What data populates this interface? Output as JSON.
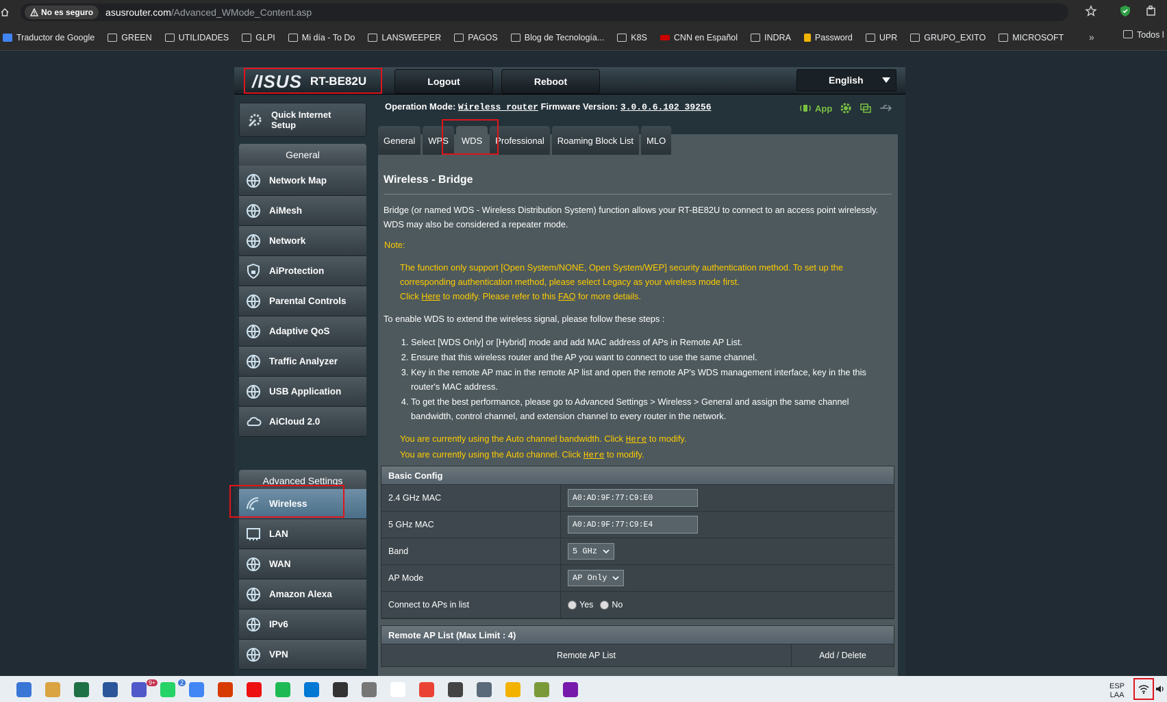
{
  "browser": {
    "security_label": "No es seguro",
    "url_host": "asusrouter.com",
    "url_path": "/Advanced_WMode_Content.asp",
    "bookmarks": [
      {
        "label": "Traductor de Google",
        "icon": "translate-icon"
      },
      {
        "label": "GREEN",
        "icon": "folder-icon"
      },
      {
        "label": "UTILIDADES",
        "icon": "folder-icon"
      },
      {
        "label": "GLPI",
        "icon": "folder-icon"
      },
      {
        "label": "Mi día - To Do",
        "icon": "todo-icon"
      },
      {
        "label": "LANSWEEPER",
        "icon": "folder-icon"
      },
      {
        "label": "PAGOS",
        "icon": "folder-icon"
      },
      {
        "label": "Blog de Tecnología...",
        "icon": "blog-icon"
      },
      {
        "label": "K8S",
        "icon": "folder-icon"
      },
      {
        "label": "CNN en Español",
        "icon": "cnn-icon"
      },
      {
        "label": "INDRA",
        "icon": "folder-icon"
      },
      {
        "label": "Password",
        "icon": "lock-icon"
      },
      {
        "label": "UPR",
        "icon": "folder-icon"
      },
      {
        "label": "GRUPO_EXITO",
        "icon": "folder-icon"
      },
      {
        "label": "MICROSOFT",
        "icon": "folder-icon"
      }
    ],
    "bookmarks_more": "»",
    "bookmarks_all": "Todos l"
  },
  "router": {
    "brand": "/ISUS",
    "model": "RT-BE82U",
    "logout_label": "Logout",
    "reboot_label": "Reboot",
    "language": "English",
    "op_mode_label": "Operation Mode:",
    "op_mode_value": "Wireless router",
    "fw_label": "Firmware Version:",
    "fw_value": "3.0.0.6.102_39256",
    "app_label": "App"
  },
  "sidebar": {
    "qis_label": "Quick Internet Setup",
    "general_header": "General",
    "general_items": [
      {
        "label": "Network Map",
        "icon": "network-map-icon"
      },
      {
        "label": "AiMesh",
        "icon": "aimesh-icon"
      },
      {
        "label": "Network",
        "icon": "globe-icon"
      },
      {
        "label": "AiProtection",
        "icon": "lock-shield-icon"
      },
      {
        "label": "Parental Controls",
        "icon": "family-icon"
      },
      {
        "label": "Adaptive QoS",
        "icon": "gauge-icon"
      },
      {
        "label": "Traffic Analyzer",
        "icon": "analyzer-icon"
      },
      {
        "label": "USB Application",
        "icon": "usb-icon"
      },
      {
        "label": "AiCloud 2.0",
        "icon": "cloud-icon"
      }
    ],
    "advanced_header": "Advanced Settings",
    "advanced_items": [
      {
        "label": "Wireless",
        "icon": "wifi-icon"
      },
      {
        "label": "LAN",
        "icon": "lan-icon"
      },
      {
        "label": "WAN",
        "icon": "globe-icon"
      },
      {
        "label": "Amazon Alexa",
        "icon": "alexa-icon"
      },
      {
        "label": "IPv6",
        "icon": "ipv6-icon"
      },
      {
        "label": "VPN",
        "icon": "vpn-icon"
      }
    ]
  },
  "tabs": [
    "General",
    "WPS",
    "WDS",
    "Professional",
    "Roaming Block List",
    "MLO"
  ],
  "main": {
    "title": "Wireless - Bridge",
    "intro": "Bridge (or named WDS - Wireless Distribution System) function allows your RT-BE82U to connect to an access point wirelessly. WDS may also be considered a repeater mode.",
    "note_label": "Note:",
    "note_text": "The function only support [Open System/NONE, Open System/WEP] security authentication method. To set up the corresponding authentication method, please select Legacy as your wireless mode first.",
    "note_click": "Click",
    "note_here": "Here",
    "note_mid": "to modify. Please refer to this",
    "note_faq": "FAQ",
    "note_end": "for more details.",
    "steps_intro": "To enable WDS to extend the wireless signal, please follow these steps :",
    "steps": [
      "Select [WDS Only] or [Hybrid] mode and add MAC address of APs in Remote AP List.",
      "Ensure that this wireless router and the AP you want to connect to use the same channel.",
      "Key in the remote AP mac in the remote AP list and open the remote AP's WDS management interface, key in the this router's MAC address.",
      "To get the best performance, please go to Advanced Settings > Wireless > General and assign the same channel bandwidth, control channel, and extension channel to every router in the network."
    ],
    "bw_note_a": "You are currently using the Auto channel bandwidth. Click",
    "bw_note_b": "to modify.",
    "ch_note_a": "You are currently using the Auto channel. Click",
    "ch_note_b": "to modify.",
    "here": "Here"
  },
  "basic_config": {
    "header": "Basic Config",
    "mac24_label": "2.4 GHz MAC",
    "mac24_value": "A0:AD:9F:77:C9:E0",
    "mac5_label": "5 GHz MAC",
    "mac5_value": "A0:AD:9F:77:C9:E4",
    "band_label": "Band",
    "band_value": "5 GHz",
    "apmode_label": "AP Mode",
    "apmode_value": "AP Only",
    "connect_label": "Connect to APs in list",
    "yes": "Yes",
    "no": "No"
  },
  "remote_ap": {
    "header": "Remote AP List (Max Limit : 4)",
    "col1": "Remote AP List",
    "col2": "Add / Delete"
  },
  "taskbar": {
    "lang_top": "ESP",
    "lang_bottom": "LAA",
    "badge_teams": "9+",
    "badge_whatsapp": "2"
  },
  "colors": {
    "accent_yellow": "#ffcc00",
    "highlight_red": "#e0141b",
    "status_green": "#7ac142"
  }
}
